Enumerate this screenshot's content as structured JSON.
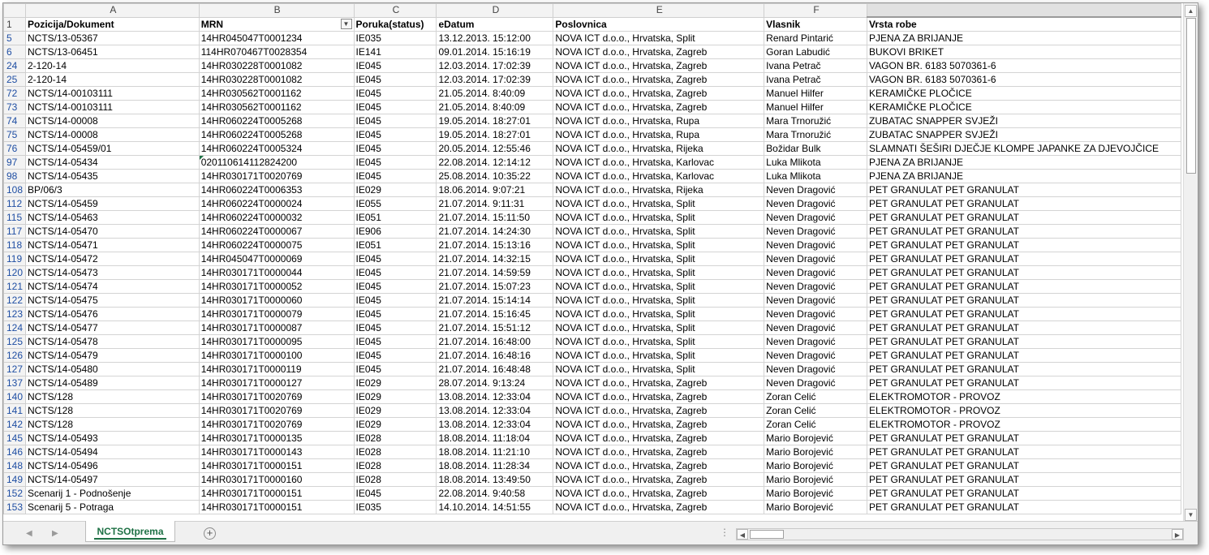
{
  "columns": [
    "A",
    "B",
    "C",
    "D",
    "E",
    "F",
    ""
  ],
  "header_row_number": "1",
  "headers": [
    "Pozicija/Dokument",
    "MRN",
    "Poruka(status)",
    "eDatum",
    "Poslovnica",
    "Vlasnik",
    "Vrsta robe"
  ],
  "filter_icon": "filter-icon",
  "rows": [
    {
      "n": "5",
      "a": "NCTS/13-05367",
      "b": "14HR045047T0001234",
      "c": "IE035",
      "d": "13.12.2013. 15:12:00",
      "e": "NOVA ICT d.o.o., Hrvatska, Split",
      "f": "Renard Pintarić",
      "g": "PJENA ZA BRIJANJE"
    },
    {
      "n": "6",
      "a": "NCTS/13-06451",
      "b": "114HR070467T0028354",
      "c": "IE141",
      "d": "09.01.2014. 15:16:19",
      "e": "NOVA ICT d.o.o., Hrvatska, Zagreb",
      "f": "Goran Labudić",
      "g": "BUKOVI BRIKET"
    },
    {
      "n": "24",
      "a": "2-120-14",
      "b": "14HR030228T0001082",
      "c": "IE045",
      "d": "12.03.2014. 17:02:39",
      "e": "NOVA ICT d.o.o., Hrvatska, Zagreb",
      "f": "Ivana Petrač",
      "g": "VAGON BR. 6183 5070361-6"
    },
    {
      "n": "25",
      "a": "2-120-14",
      "b": "14HR030228T0001082",
      "c": "IE045",
      "d": "12.03.2014. 17:02:39",
      "e": "NOVA ICT d.o.o., Hrvatska, Zagreb",
      "f": "Ivana Petrač",
      "g": "VAGON BR. 6183 5070361-6"
    },
    {
      "n": "72",
      "a": "NCTS/14-00103111",
      "b": "14HR030562T0001162",
      "c": "IE045",
      "d": "21.05.2014. 8:40:09",
      "e": "NOVA ICT d.o.o., Hrvatska, Zagreb",
      "f": "Manuel Hilfer",
      "g": "KERAMIČKE PLOČICE"
    },
    {
      "n": "73",
      "a": "NCTS/14-00103111",
      "b": "14HR030562T0001162",
      "c": "IE045",
      "d": "21.05.2014. 8:40:09",
      "e": "NOVA ICT d.o.o., Hrvatska, Zagreb",
      "f": "Manuel Hilfer",
      "g": "KERAMIČKE PLOČICE"
    },
    {
      "n": "74",
      "a": "NCTS/14-00008",
      "b": "14HR060224T0005268",
      "c": "IE045",
      "d": "19.05.2014. 18:27:01",
      "e": "NOVA ICT d.o.o., Hrvatska, Rupa",
      "f": "Mara Trnoružić",
      "g": "ZUBATAC SNAPPER SVJEŽI"
    },
    {
      "n": "75",
      "a": "NCTS/14-00008",
      "b": "14HR060224T0005268",
      "c": "IE045",
      "d": "19.05.2014. 18:27:01",
      "e": "NOVA ICT d.o.o., Hrvatska, Rupa",
      "f": "Mara Trnoružić",
      "g": "ZUBATAC SNAPPER SVJEŽI"
    },
    {
      "n": "76",
      "a": "NCTS/14-05459/01",
      "b": "14HR060224T0005324",
      "c": "IE045",
      "d": "20.05.2014. 12:55:46",
      "e": "NOVA ICT d.o.o., Hrvatska, Rijeka",
      "f": "Božidar Bulk",
      "g": "SLAMNATI ŠEŠIRI DJEČJE KLOMPE JAPANKE ZA DJEVOJČICE"
    },
    {
      "n": "97",
      "a": "NCTS/14-05434",
      "b": "020110614112824200",
      "c": "IE045",
      "d": "22.08.2014. 12:14:12",
      "e": "NOVA ICT d.o.o., Hrvatska, Karlovac",
      "f": "Luka Mlikota",
      "g": "PJENA ZA BRIJANJE"
    },
    {
      "n": "98",
      "a": "NCTS/14-05435",
      "b": "14HR030171T0020769",
      "c": "IE045",
      "d": "25.08.2014. 10:35:22",
      "e": "NOVA ICT d.o.o., Hrvatska, Karlovac",
      "f": "Luka Mlikota",
      "g": "PJENA ZA BRIJANJE"
    },
    {
      "n": "108",
      "a": "BP/06/3",
      "b": "14HR060224T0006353",
      "c": "IE029",
      "d": "18.06.2014. 9:07:21",
      "e": "NOVA ICT d.o.o., Hrvatska, Rijeka",
      "f": "Neven Dragović",
      "g": "PET GRANULAT  PET GRANULAT"
    },
    {
      "n": "112",
      "a": "NCTS/14-05459",
      "b": "14HR060224T0000024",
      "c": "IE055",
      "d": "21.07.2014. 9:11:31",
      "e": "NOVA ICT d.o.o., Hrvatska, Split",
      "f": "Neven Dragović",
      "g": "PET GRANULAT  PET GRANULAT"
    },
    {
      "n": "115",
      "a": "NCTS/14-05463",
      "b": "14HR060224T0000032",
      "c": "IE051",
      "d": "21.07.2014. 15:11:50",
      "e": "NOVA ICT d.o.o., Hrvatska, Split",
      "f": "Neven Dragović",
      "g": "PET GRANULAT  PET GRANULAT"
    },
    {
      "n": "117",
      "a": "NCTS/14-05470",
      "b": "14HR060224T0000067",
      "c": "IE906",
      "d": "21.07.2014. 14:24:30",
      "e": "NOVA ICT d.o.o., Hrvatska, Split",
      "f": "Neven Dragović",
      "g": "PET GRANULAT  PET GRANULAT"
    },
    {
      "n": "118",
      "a": "NCTS/14-05471",
      "b": "14HR060224T0000075",
      "c": "IE051",
      "d": "21.07.2014. 15:13:16",
      "e": "NOVA ICT d.o.o., Hrvatska, Split",
      "f": "Neven Dragović",
      "g": "PET GRANULAT  PET GRANULAT"
    },
    {
      "n": "119",
      "a": "NCTS/14-05472",
      "b": "14HR045047T0000069",
      "c": "IE045",
      "d": "21.07.2014. 14:32:15",
      "e": "NOVA ICT d.o.o., Hrvatska, Split",
      "f": "Neven Dragović",
      "g": "PET GRANULAT  PET GRANULAT"
    },
    {
      "n": "120",
      "a": "NCTS/14-05473",
      "b": "14HR030171T0000044",
      "c": "IE045",
      "d": "21.07.2014. 14:59:59",
      "e": "NOVA ICT d.o.o., Hrvatska, Split",
      "f": "Neven Dragović",
      "g": "PET GRANULAT  PET GRANULAT"
    },
    {
      "n": "121",
      "a": "NCTS/14-05474",
      "b": "14HR030171T0000052",
      "c": "IE045",
      "d": "21.07.2014. 15:07:23",
      "e": "NOVA ICT d.o.o., Hrvatska, Split",
      "f": "Neven Dragović",
      "g": "PET GRANULAT  PET GRANULAT"
    },
    {
      "n": "122",
      "a": "NCTS/14-05475",
      "b": "14HR030171T0000060",
      "c": "IE045",
      "d": "21.07.2014. 15:14:14",
      "e": "NOVA ICT d.o.o., Hrvatska, Split",
      "f": "Neven Dragović",
      "g": "PET GRANULAT  PET GRANULAT"
    },
    {
      "n": "123",
      "a": "NCTS/14-05476",
      "b": "14HR030171T0000079",
      "c": "IE045",
      "d": "21.07.2014. 15:16:45",
      "e": "NOVA ICT d.o.o., Hrvatska, Split",
      "f": "Neven Dragović",
      "g": "PET GRANULAT  PET GRANULAT"
    },
    {
      "n": "124",
      "a": "NCTS/14-05477",
      "b": "14HR030171T0000087",
      "c": "IE045",
      "d": "21.07.2014. 15:51:12",
      "e": "NOVA ICT d.o.o., Hrvatska, Split",
      "f": "Neven Dragović",
      "g": "PET GRANULAT  PET GRANULAT"
    },
    {
      "n": "125",
      "a": "NCTS/14-05478",
      "b": "14HR030171T0000095",
      "c": "IE045",
      "d": "21.07.2014. 16:48:00",
      "e": "NOVA ICT d.o.o., Hrvatska, Split",
      "f": "Neven Dragović",
      "g": "PET GRANULAT  PET GRANULAT"
    },
    {
      "n": "126",
      "a": "NCTS/14-05479",
      "b": "14HR030171T0000100",
      "c": "IE045",
      "d": "21.07.2014. 16:48:16",
      "e": "NOVA ICT d.o.o., Hrvatska, Split",
      "f": "Neven Dragović",
      "g": "PET GRANULAT  PET GRANULAT"
    },
    {
      "n": "127",
      "a": "NCTS/14-05480",
      "b": "14HR030171T0000119",
      "c": "IE045",
      "d": "21.07.2014. 16:48:48",
      "e": "NOVA ICT d.o.o., Hrvatska, Split",
      "f": "Neven Dragović",
      "g": "PET GRANULAT  PET GRANULAT"
    },
    {
      "n": "137",
      "a": "NCTS/14-05489",
      "b": "14HR030171T0000127",
      "c": "IE029",
      "d": "28.07.2014. 9:13:24",
      "e": "NOVA ICT d.o.o., Hrvatska, Zagreb",
      "f": "Neven Dragović",
      "g": "PET GRANULAT  PET GRANULAT"
    },
    {
      "n": "140",
      "a": "NCTS/128",
      "b": "14HR030171T0020769",
      "c": "IE029",
      "d": "13.08.2014. 12:33:04",
      "e": "NOVA ICT d.o.o., Hrvatska, Zagreb",
      "f": "Zoran Celić",
      "g": "ELEKTROMOTOR - PROVOZ"
    },
    {
      "n": "141",
      "a": "NCTS/128",
      "b": "14HR030171T0020769",
      "c": "IE029",
      "d": "13.08.2014. 12:33:04",
      "e": "NOVA ICT d.o.o., Hrvatska, Zagreb",
      "f": "Zoran Celić",
      "g": "ELEKTROMOTOR - PROVOZ"
    },
    {
      "n": "142",
      "a": "NCTS/128",
      "b": "14HR030171T0020769",
      "c": "IE029",
      "d": "13.08.2014. 12:33:04",
      "e": "NOVA ICT d.o.o., Hrvatska, Zagreb",
      "f": "Zoran Celić",
      "g": "ELEKTROMOTOR - PROVOZ"
    },
    {
      "n": "145",
      "a": "NCTS/14-05493",
      "b": "14HR030171T0000135",
      "c": "IE028",
      "d": "18.08.2014. 11:18:04",
      "e": "NOVA ICT d.o.o., Hrvatska, Zagreb",
      "f": "Mario Borojević",
      "g": "PET GRANULAT  PET GRANULAT"
    },
    {
      "n": "146",
      "a": "NCTS/14-05494",
      "b": "14HR030171T0000143",
      "c": "IE028",
      "d": "18.08.2014. 11:21:10",
      "e": "NOVA ICT d.o.o., Hrvatska, Zagreb",
      "f": "Mario Borojević",
      "g": "PET GRANULAT  PET GRANULAT"
    },
    {
      "n": "148",
      "a": "NCTS/14-05496",
      "b": "14HR030171T0000151",
      "c": "IE028",
      "d": "18.08.2014. 11:28:34",
      "e": "NOVA ICT d.o.o., Hrvatska, Zagreb",
      "f": "Mario Borojević",
      "g": "PET GRANULAT  PET GRANULAT"
    },
    {
      "n": "149",
      "a": "NCTS/14-05497",
      "b": "14HR030171T0000160",
      "c": "IE028",
      "d": "18.08.2014. 13:49:50",
      "e": "NOVA ICT d.o.o., Hrvatska, Zagreb",
      "f": "Mario Borojević",
      "g": "PET GRANULAT  PET GRANULAT"
    },
    {
      "n": "152",
      "a": "Scenarij 1 - Podnošenje",
      "b": "14HR030171T0000151",
      "c": "IE045",
      "d": "22.08.2014. 9:40:58",
      "e": "NOVA ICT d.o.o., Hrvatska, Zagreb",
      "f": "Mario Borojević",
      "g": "PET GRANULAT  PET GRANULAT"
    },
    {
      "n": "153",
      "a": "Scenarij 5 - Potraga",
      "b": "14HR030171T0000151",
      "c": "IE035",
      "d": "14.10.2014. 14:51:55",
      "e": "NOVA ICT d.o.o., Hrvatska, Zagreb",
      "f": "Mario Borojević",
      "g": "PET GRANULAT  PET GRANULAT"
    }
  ],
  "sheet_tab": "NCTSOtprema",
  "icons": {
    "prev_sheet": "◀",
    "next_sheet": "▶",
    "add_sheet": "+",
    "scroll_up": "▲",
    "scroll_down": "▼",
    "scroll_left": "◀",
    "scroll_right": "▶",
    "splitter": "⋮"
  }
}
